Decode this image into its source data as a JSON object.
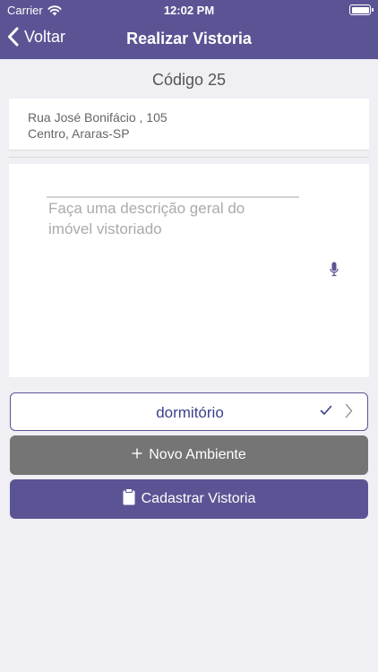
{
  "status_bar": {
    "carrier": "Carrier",
    "time": "12:02 PM"
  },
  "nav": {
    "back_label": "Voltar",
    "title": "Realizar Vistoria"
  },
  "code": "Código 25",
  "address": {
    "line1": "Rua José Bonifácio , 105",
    "line2": "Centro, Araras-SP"
  },
  "description": {
    "placeholder": "Faça uma descrição geral do imóvel vistoriado"
  },
  "room": {
    "label": "dormitório"
  },
  "buttons": {
    "new_room": "Novo Ambiente",
    "save": "Cadastrar Vistoria"
  },
  "colors": {
    "primary": "#5b5494",
    "secondary_button": "#757575",
    "background": "#efeff4",
    "room_text": "#3d3f8c"
  }
}
